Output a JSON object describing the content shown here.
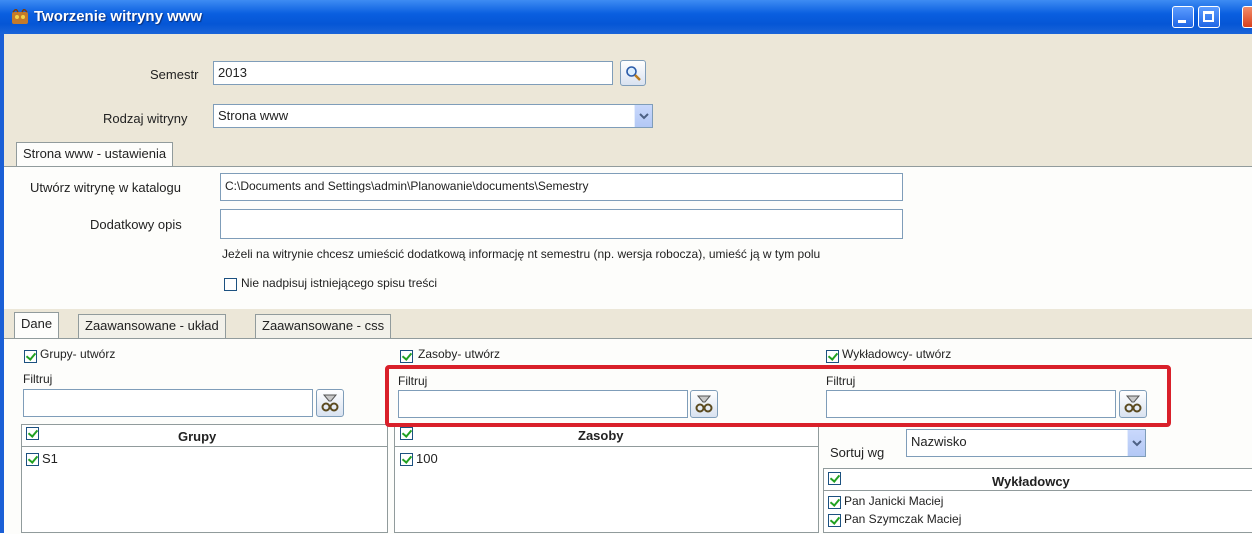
{
  "window": {
    "title": "Tworzenie witryny www"
  },
  "semestr": {
    "label": "Semestr",
    "value": "2013"
  },
  "rodzaj": {
    "label": "Rodzaj witryny",
    "value": "Strona www"
  },
  "settings_tab": {
    "label": "Strona www - ustawienia"
  },
  "katalog": {
    "label": "Utwórz witrynę w katalogu",
    "value": "C:\\Documents and Settings\\admin\\Planowanie\\documents\\Semestry"
  },
  "opis": {
    "label": "Dodatkowy opis",
    "value": "",
    "hint": "Jeżeli na witrynie chcesz umieścić dodatkową informację nt semestru (np. wersja robocza), umieść ją w tym polu"
  },
  "nadpisuj": {
    "label": "Nie nadpisuj istniejącego spisu treści",
    "checked": false
  },
  "tabs": [
    {
      "label": "Dane"
    },
    {
      "label": "Zaawansowane - układ"
    },
    {
      "label": "Zaawansowane - css"
    }
  ],
  "grupy": {
    "create_label": "Grupy- utwórz",
    "filter_label": "Filtruj",
    "filter_value": "",
    "header": "Grupy",
    "items": [
      "S1"
    ]
  },
  "zasoby": {
    "create_label": "Zasoby- utwórz",
    "filter_label": "Filtruj",
    "filter_value": "",
    "header": "Zasoby",
    "items": [
      "100"
    ]
  },
  "wykladowcy": {
    "create_label": "Wykładowcy- utwórz",
    "filter_label": "Filtruj",
    "filter_value": "",
    "sort_label": "Sortuj wg",
    "sort_value": "Nazwisko",
    "header": "Wykładowcy",
    "items": [
      "Pan Janicki Maciej",
      "Pan Szymczak Maciej"
    ]
  },
  "colors": {
    "titlebar": "#0556d6",
    "highlight": "#d9202a",
    "check": "#21a121"
  }
}
